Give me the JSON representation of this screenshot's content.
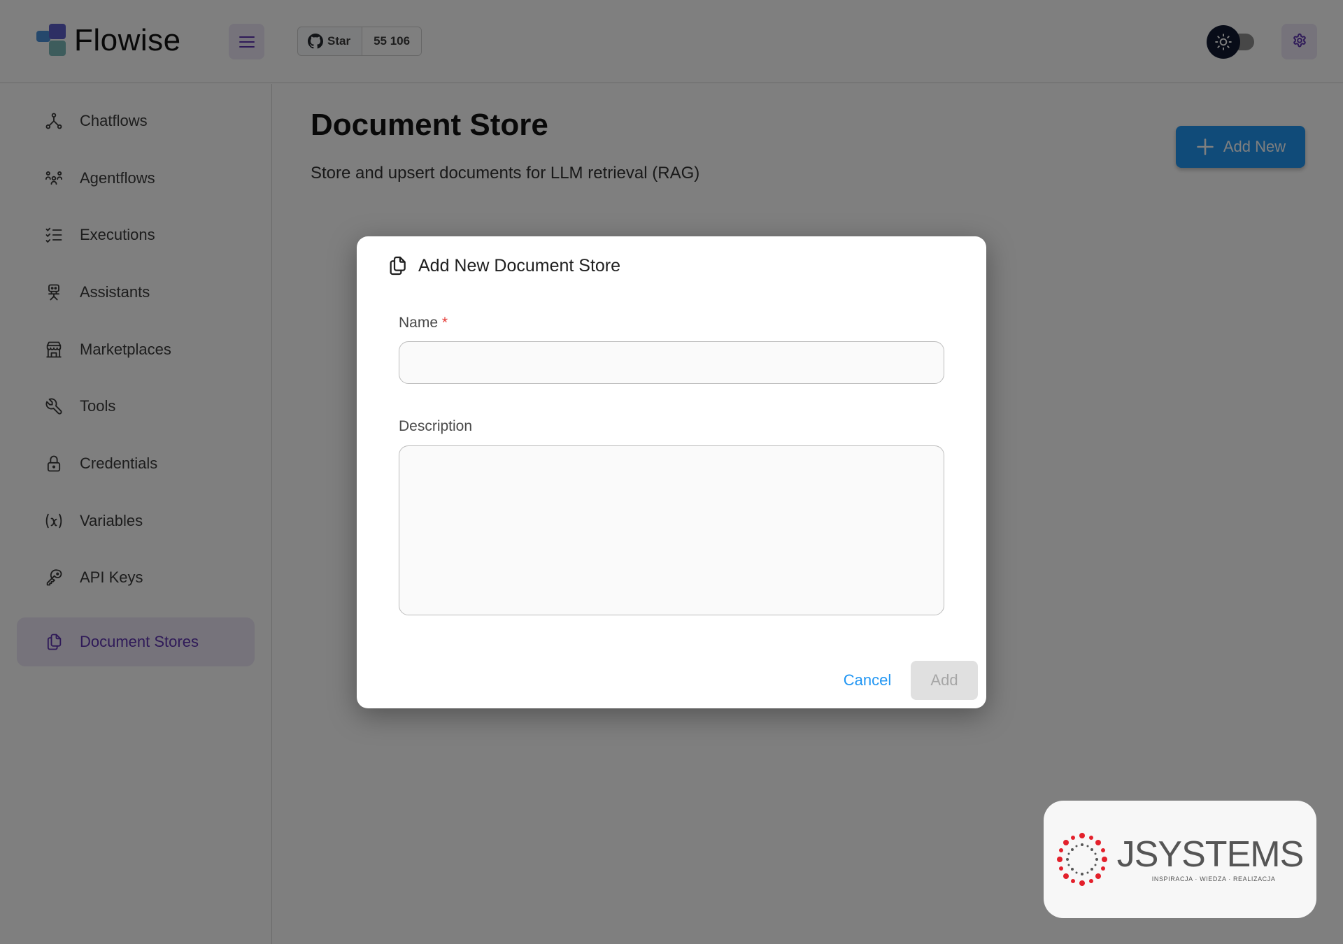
{
  "header": {
    "app_name": "Flowise",
    "github": {
      "star_label": "Star",
      "star_count": "55 106"
    }
  },
  "sidebar": {
    "items": [
      {
        "label": "Chatflows",
        "icon": "hierarchy-icon",
        "active": false
      },
      {
        "label": "Agentflows",
        "icon": "users-group-icon",
        "active": false
      },
      {
        "label": "Executions",
        "icon": "list-check-icon",
        "active": false
      },
      {
        "label": "Assistants",
        "icon": "robot-icon",
        "active": false
      },
      {
        "label": "Marketplaces",
        "icon": "building-store-icon",
        "active": false
      },
      {
        "label": "Tools",
        "icon": "tool-icon",
        "active": false
      },
      {
        "label": "Credentials",
        "icon": "lock-icon",
        "active": false
      },
      {
        "label": "Variables",
        "icon": "variable-icon",
        "active": false
      },
      {
        "label": "API Keys",
        "icon": "key-icon",
        "active": false
      },
      {
        "label": "Document Stores",
        "icon": "files-icon",
        "active": true
      }
    ]
  },
  "main": {
    "title": "Document Store",
    "subtitle": "Store and upsert documents for LLM retrieval (RAG)",
    "add_new_label": "Add New"
  },
  "dialog": {
    "title": "Add New Document Store",
    "name_label": "Name",
    "name_required": "*",
    "name_value": "",
    "description_label": "Description",
    "description_value": "",
    "cancel_label": "Cancel",
    "add_label": "Add"
  },
  "watermark": {
    "brand": "JSYSTEMS",
    "tagline": "INSPIRACJA · WIEDZA · REALIZACJA"
  },
  "colors": {
    "primary": "#2196f3",
    "active_nav_bg": "#ede7f6",
    "active_nav_text": "#5e35b1",
    "required": "#e53935",
    "brand_red": "#e3202b"
  }
}
